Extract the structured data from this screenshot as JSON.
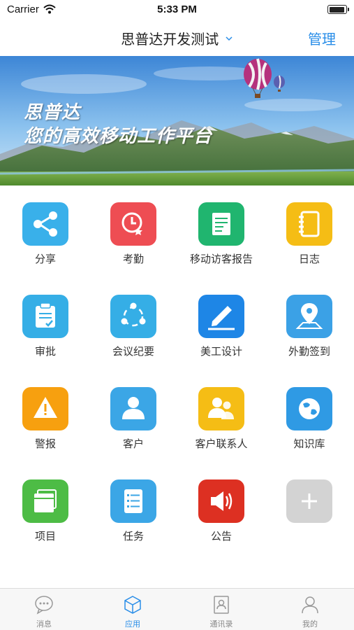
{
  "status_bar": {
    "carrier": "Carrier",
    "time": "5:33 PM"
  },
  "nav": {
    "title": "思普达开发测试",
    "manage_label": "管理"
  },
  "banner": {
    "line1": "思普达",
    "line2": "您的高效移动工作平台"
  },
  "apps": [
    {
      "label": "分享",
      "icon": "share-icon",
      "color": "#39b0ea"
    },
    {
      "label": "考勤",
      "icon": "attendance-clock-icon",
      "color": "#ee4d53"
    },
    {
      "label": "移动访客报告",
      "icon": "report-document-icon",
      "color": "#20b56f"
    },
    {
      "label": "日志",
      "icon": "notebook-icon",
      "color": "#f5bd15"
    },
    {
      "label": "审批",
      "icon": "approval-clipboard-icon",
      "color": "#35aee6"
    },
    {
      "label": "会议纪要",
      "icon": "meeting-people-icon",
      "color": "#35aee6"
    },
    {
      "label": "美工设计",
      "icon": "pencil-design-icon",
      "color": "#1e86e6"
    },
    {
      "label": "外勤签到",
      "icon": "location-pin-icon",
      "color": "#3ba1e6"
    },
    {
      "label": "警报",
      "icon": "warning-icon",
      "color": "#f7a00f"
    },
    {
      "label": "客户",
      "icon": "customer-person-icon",
      "color": "#3ba6e6"
    },
    {
      "label": "客户联系人",
      "icon": "contacts-people-icon",
      "color": "#f5bd15"
    },
    {
      "label": "知识库",
      "icon": "globe-icon",
      "color": "#2f9ae4"
    },
    {
      "label": "项目",
      "icon": "project-folder-icon",
      "color": "#4dbc45"
    },
    {
      "label": "任务",
      "icon": "task-list-icon",
      "color": "#3ba6e6"
    },
    {
      "label": "公告",
      "icon": "megaphone-icon",
      "color": "#dd3022"
    },
    {
      "label": "",
      "icon": "add-icon",
      "color": "#d3d3d3"
    }
  ],
  "tabs": [
    {
      "label": "消息",
      "icon": "chat-bubble-icon",
      "active": false
    },
    {
      "label": "应用",
      "icon": "cube-icon",
      "active": true
    },
    {
      "label": "通讯录",
      "icon": "address-book-icon",
      "active": false
    },
    {
      "label": "我的",
      "icon": "profile-icon",
      "active": false
    }
  ]
}
